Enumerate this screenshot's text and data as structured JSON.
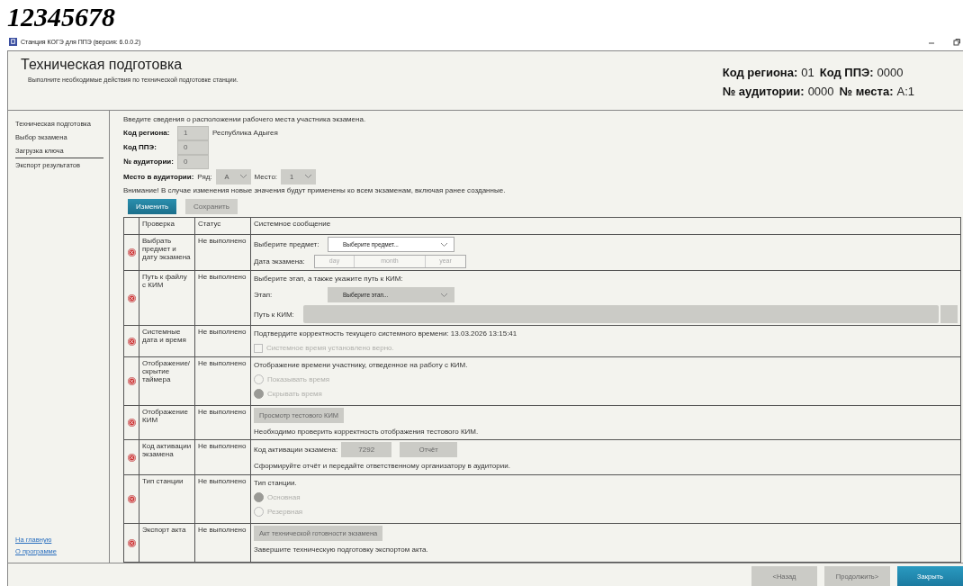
{
  "caption": "12345678",
  "window": {
    "title": "Станция КОГЭ для ППЭ (версия: 6.0.0.2)"
  },
  "header": {
    "title": "Техническая подготовка",
    "subtitle": "Выполните необходимые действия по технической подготовке станции.",
    "info": [
      [
        {
          "label": "Код региона:",
          "value": "01"
        },
        {
          "label": "Код ППЭ:",
          "value": "0000"
        }
      ],
      [
        {
          "label": "№ аудитории:",
          "value": "0000"
        },
        {
          "label": "№ места:",
          "value": "А:1"
        }
      ]
    ]
  },
  "sidebar": {
    "items": [
      {
        "label": "Техническая подготовка",
        "separator": false
      },
      {
        "label": "Выбор экзамена",
        "separator": false
      },
      {
        "label": "Загрузка ключа",
        "separator": true
      },
      {
        "label": "Экспорт результатов",
        "separator": false
      }
    ],
    "links": [
      "На главную",
      "О программе"
    ]
  },
  "location": {
    "intro": "Введите сведения о расположении рабочего места участника экзамена.",
    "fields": [
      {
        "label": "Код региона:",
        "value": "1",
        "note": "Республика Адыгея"
      },
      {
        "label": "Код ППЭ:",
        "value": "0"
      },
      {
        "label": "№ аудитории:",
        "value": "0"
      }
    ],
    "seat": {
      "label": "Место в аудитории:",
      "row_label": "Ряд:",
      "row_value": "А",
      "seat_label": "Место:",
      "seat_value": "1"
    },
    "warning": "Внимание! В случае изменения новые значения будут применены ко всем экзаменам, включая ранее созданные.",
    "buttons": [
      {
        "label": "Изменить",
        "disabled": false
      },
      {
        "label": "Сохранить",
        "disabled": true
      }
    ]
  },
  "table": {
    "columns": [
      "Проверка",
      "Статус",
      "Системное сообщение"
    ],
    "rows": [
      {
        "done": false,
        "check": "Выбрать предмет и дату экзамена",
        "status": "Не выполнено",
        "message": [
          {
            "kind": "select",
            "label": "Выберите предмет:",
            "value": "Выберите предмет...",
            "disabled": false
          },
          {
            "kind": "date",
            "label": "Дата экзамена:",
            "placeholders": [
              "day",
              "month",
              "year"
            ]
          }
        ]
      },
      {
        "done": false,
        "check": "Путь к файлу с КИМ",
        "status": "Не выполнено",
        "message": [
          {
            "kind": "text",
            "text": "Выберите этап, а также укажите путь к КИМ:"
          },
          {
            "kind": "select",
            "label": "Этап:",
            "value": "Выберите этап...",
            "disabled": true
          },
          {
            "kind": "path",
            "label": "Путь к КИМ:"
          }
        ]
      },
      {
        "done": false,
        "check": "Системные дата и время",
        "status": "Не выполнено",
        "message": [
          {
            "kind": "text",
            "text": "Подтвердите корректность текущего системного времени: 13.03.2026 13:15:41"
          },
          {
            "kind": "checkbox",
            "label": "Системное время установлено верно.",
            "checked": false
          }
        ]
      },
      {
        "done": false,
        "check": "Отображение/ скрытие таймера",
        "status": "Не выполнено",
        "message": [
          {
            "kind": "text",
            "text": "Отображение времени участнику, отведенное на работу с КИМ."
          },
          {
            "kind": "radio",
            "label": "Показывать время",
            "selected": false
          },
          {
            "kind": "radio",
            "label": "Скрывать время",
            "selected": true
          }
        ]
      },
      {
        "done": false,
        "check": "Отображение КИМ",
        "status": "Не выполнено",
        "message": [
          {
            "kind": "button",
            "label": "Просмотр тестового КИМ"
          },
          {
            "kind": "text",
            "text": "Необходимо проверить корректность отображения тестового КИМ."
          }
        ]
      },
      {
        "done": false,
        "check": "Код активации экзамена",
        "status": "Не выполнено",
        "message": [
          {
            "kind": "code",
            "label": "Код активации экзамена:",
            "value": "7292",
            "button": "Отчёт"
          },
          {
            "kind": "text",
            "text": "Сформируйте отчёт и передайте ответственному организатору в аудитории."
          }
        ]
      },
      {
        "done": false,
        "check": "Тип станции",
        "status": "Не выполнено",
        "message": [
          {
            "kind": "text",
            "text": "Тип станции."
          },
          {
            "kind": "radio",
            "label": "Основная",
            "selected": true
          },
          {
            "kind": "radio",
            "label": "Резервная",
            "selected": false
          }
        ]
      },
      {
        "done": false,
        "check": "Экспорт акта",
        "status": "Не выполнено",
        "message": [
          {
            "kind": "button",
            "label": "Акт технической готовности экзамена"
          },
          {
            "kind": "text",
            "text": "Завершите техническую подготовку экспортом акта."
          }
        ]
      }
    ]
  },
  "footer": {
    "buttons": [
      {
        "label": "<Назад",
        "disabled": true
      },
      {
        "label": "Продолжить>",
        "disabled": true
      },
      {
        "label": "Закрыть",
        "disabled": false
      }
    ]
  }
}
